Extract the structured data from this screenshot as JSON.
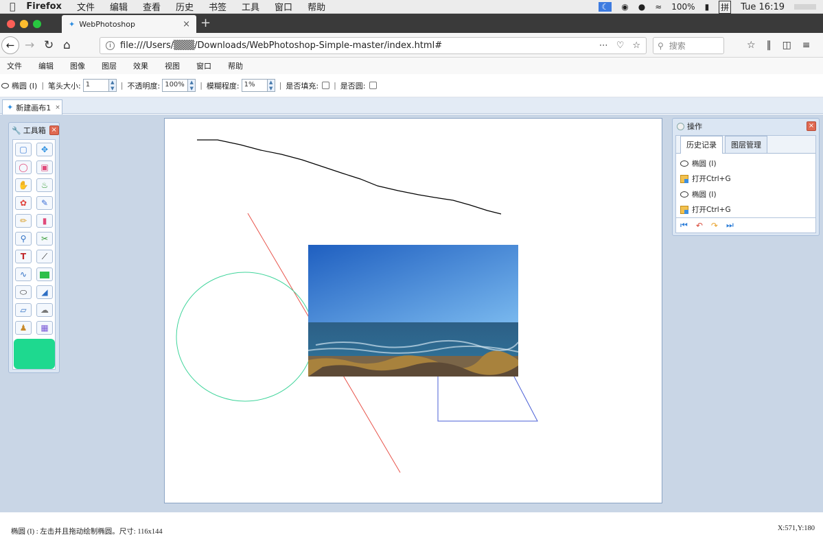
{
  "mac_menubar": {
    "app": "Firefox",
    "items": [
      "文件",
      "编辑",
      "查看",
      "历史",
      "书签",
      "工具",
      "窗口",
      "帮助"
    ],
    "battery": "100%",
    "input_method": "拼",
    "clock": "Tue 16:19"
  },
  "browser": {
    "tab_title": "WebPhotoshop",
    "url": "file:///Users/▒▒▒/Downloads/WebPhotoshop-Simple-master/index.html#",
    "search_placeholder": "搜索"
  },
  "app_menu": [
    "文件",
    "编辑",
    "图像",
    "图层",
    "效果",
    "视图",
    "窗口",
    "帮助"
  ],
  "options": {
    "tool_name": "椭圆 (I)",
    "brush_label": "笔头大小:",
    "brush_value": "1",
    "opacity_label": "不透明度:",
    "opacity_value": "100%",
    "blur_label": "模糊程度:",
    "blur_value": "1%",
    "fill_label": "是否填充:",
    "circle_label": "是否圆:",
    "fill_checked": false,
    "circle_checked": false
  },
  "doc_tab": {
    "label": "新建画布1",
    "close": "×"
  },
  "toolbox": {
    "title": "工具箱",
    "tools": [
      "rect-select-icon",
      "move-icon",
      "lasso-icon",
      "magic-select-icon",
      "hand-icon",
      "bucket-icon",
      "color-wheel-icon",
      "brush-icon",
      "pencil-icon",
      "eraser-icon",
      "zoom-icon",
      "scissors-icon",
      "text-icon",
      "line-icon",
      "curve-icon",
      "gradient-icon",
      "ellipse-icon",
      "triangle-icon",
      "polygon-icon",
      "blob-icon",
      "stamp-icon",
      "palette-icon"
    ],
    "current_color": "#1ed98f"
  },
  "ops_panel": {
    "title": "操作",
    "tabs": [
      "历史记录",
      "图层管理"
    ],
    "active_tab": 0,
    "history": [
      {
        "icon": "ellipse-icon",
        "label": "椭圆 (I)"
      },
      {
        "icon": "open-file-icon",
        "label": "打开Ctrl+G"
      },
      {
        "icon": "ellipse-icon",
        "label": "椭圆 (I)"
      },
      {
        "icon": "open-file-icon",
        "label": "打开Ctrl+G"
      }
    ],
    "footer_icons": [
      "first-icon",
      "undo-icon",
      "redo-icon",
      "last-icon"
    ]
  },
  "canvas": {
    "shapes": [
      "freehand-stroke",
      "red-line",
      "green-ellipse",
      "blue-polygon",
      "photo-layer"
    ],
    "colors": {
      "stroke": "#000000",
      "line": "#e8534a",
      "ellipse": "#3ed49a",
      "polygon": "#4a5fd6"
    }
  },
  "status": {
    "message": "椭圆 (I) : 左击并且拖动绘制椭圆。尺寸: 116x144",
    "coords": "X:571,Y:180"
  }
}
